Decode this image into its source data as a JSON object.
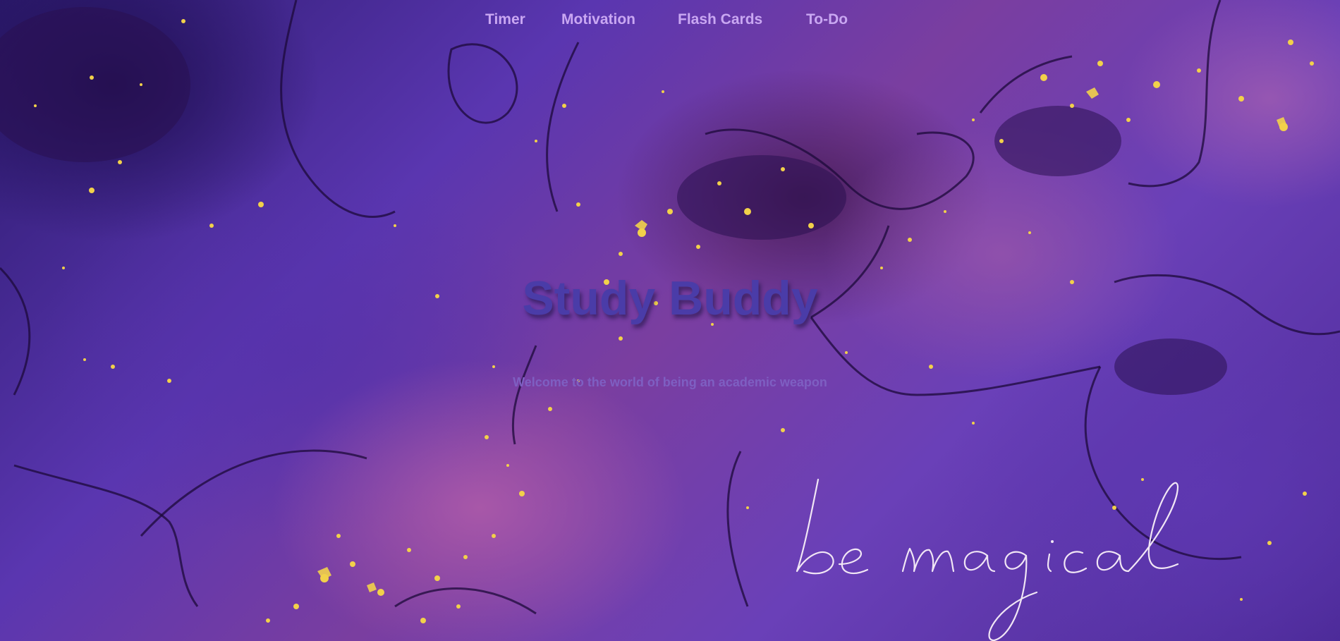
{
  "nav": {
    "items": [
      {
        "label": "Timer"
      },
      {
        "label": "Motivation"
      },
      {
        "label": "Flash Cards"
      },
      {
        "label": "To-Do"
      }
    ]
  },
  "hero": {
    "title": "Study Buddy",
    "subtitle": "Welcome to the world of being an academic weapon"
  },
  "decor": {
    "script_text": "be magical",
    "accent_gold": "#f2d14a",
    "nav_color": "#c9a7f2",
    "title_color": "#4a3ca8"
  }
}
